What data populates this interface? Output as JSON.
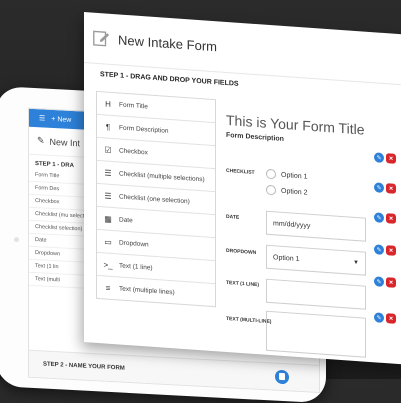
{
  "tablet": {
    "add_label": "+ New",
    "title": "New Int",
    "step1": "STEP 1 - DRA",
    "items": [
      "Form Title",
      "Form Des",
      "Checkbox",
      "Checklist (mu selection)",
      "Checklist selection)",
      "Date",
      "Dropdown",
      "Text (1 lin",
      "Text (multi"
    ],
    "step2": "STEP 2 - NAME YOUR FORM"
  },
  "panel": {
    "title": "New Intake Form",
    "step1": "STEP 1 - DRAG AND DROP YOUR FIELDS",
    "fields": [
      {
        "icon": "H",
        "label": "Form Title",
        "icon_name": "heading-icon"
      },
      {
        "icon": "¶",
        "label": "Form Description",
        "icon_name": "paragraph-icon"
      },
      {
        "icon": "☑",
        "label": "Checkbox",
        "icon_name": "checkbox-icon"
      },
      {
        "icon": "☰",
        "label": "Checklist (multiple selections)",
        "icon_name": "checklist-icon"
      },
      {
        "icon": "☰",
        "label": "Checklist (one selection)",
        "icon_name": "checklist-single-icon"
      },
      {
        "icon": "▦",
        "label": "Date",
        "icon_name": "calendar-icon"
      },
      {
        "icon": "▭",
        "label": "Dropdown",
        "icon_name": "dropdown-icon"
      },
      {
        "icon": ">_",
        "label": "Text (1 line)",
        "icon_name": "text-line-icon"
      },
      {
        "icon": "≡",
        "label": "Text (multiple lines)",
        "icon_name": "text-multiline-icon"
      }
    ],
    "form": {
      "title": "This is Your Form Title",
      "description": "Form Description",
      "checklist_label": "CHECKLIST",
      "option1": "Option 1",
      "option2": "Option 2",
      "date_label": "DATE",
      "date_placeholder": "mm/dd/yyyy",
      "dropdown_label": "DROPDOWN",
      "dropdown_value": "Option 1",
      "text1_label": "TEXT (1 LINE)",
      "textm_label": "TEXT (MULTI-LINE)"
    }
  },
  "colors": {
    "accent": "#2d81d8",
    "danger": "#d9262c"
  }
}
